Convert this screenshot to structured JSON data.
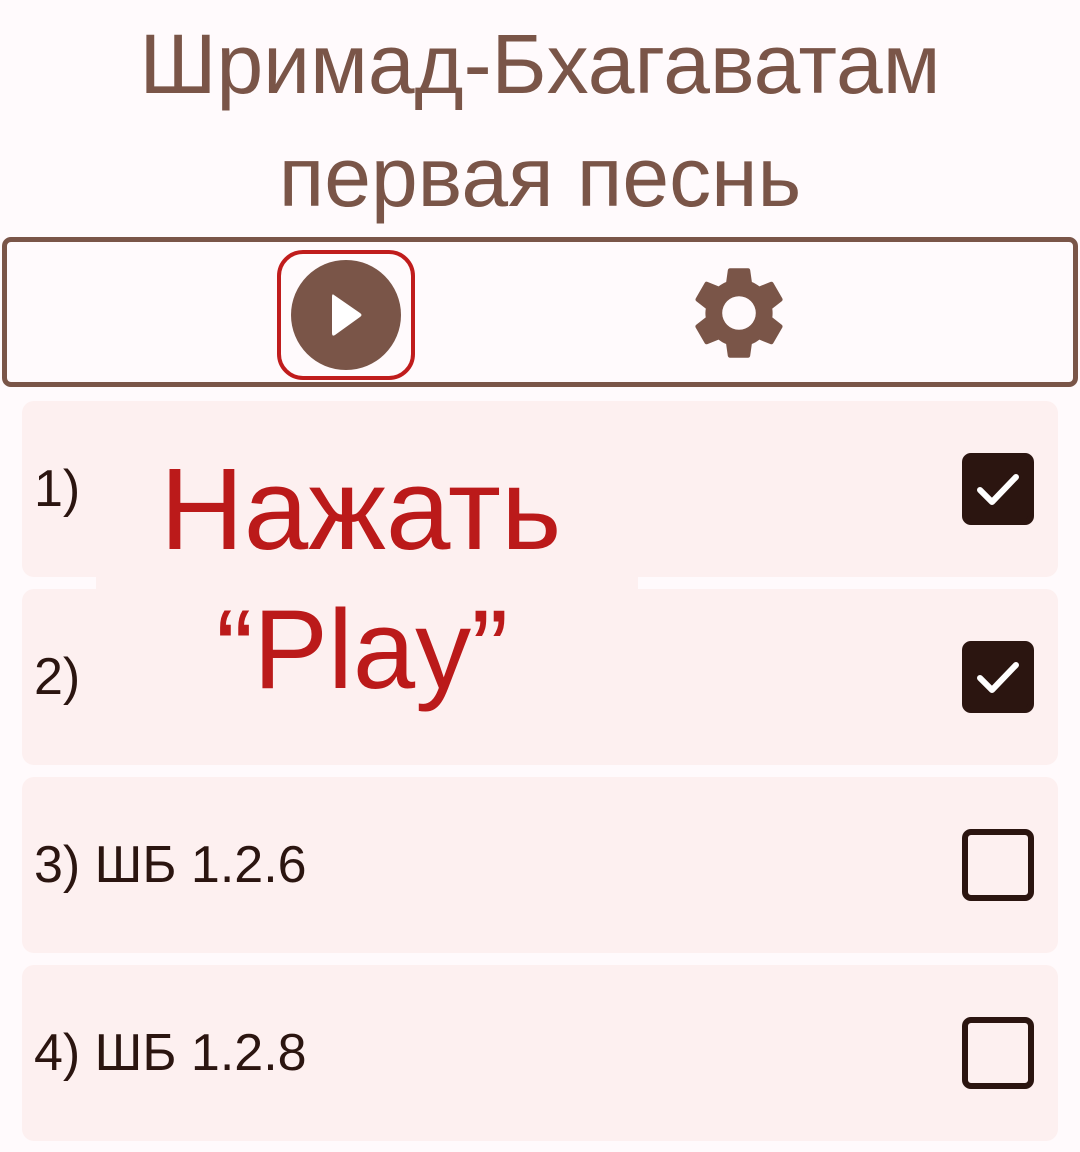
{
  "header": {
    "title_line1": "Шримад-Бхагаватам",
    "title_line2": "первая песнь"
  },
  "toolbar": {
    "play_icon": "play-circle-icon",
    "settings_icon": "gear-icon"
  },
  "items": [
    {
      "label": "1)",
      "checked": true
    },
    {
      "label": "2)",
      "checked": true
    },
    {
      "label": "3) ШБ 1.2.6",
      "checked": false
    },
    {
      "label": "4) ШБ 1.2.8",
      "checked": false
    }
  ],
  "annotation": {
    "line1": "Нажать",
    "line2": "“Play”"
  },
  "colors": {
    "brand": "#7a5548",
    "annotation": "#bb1a1a",
    "card": "#fdf0f0",
    "checkbox": "#2b1510"
  }
}
